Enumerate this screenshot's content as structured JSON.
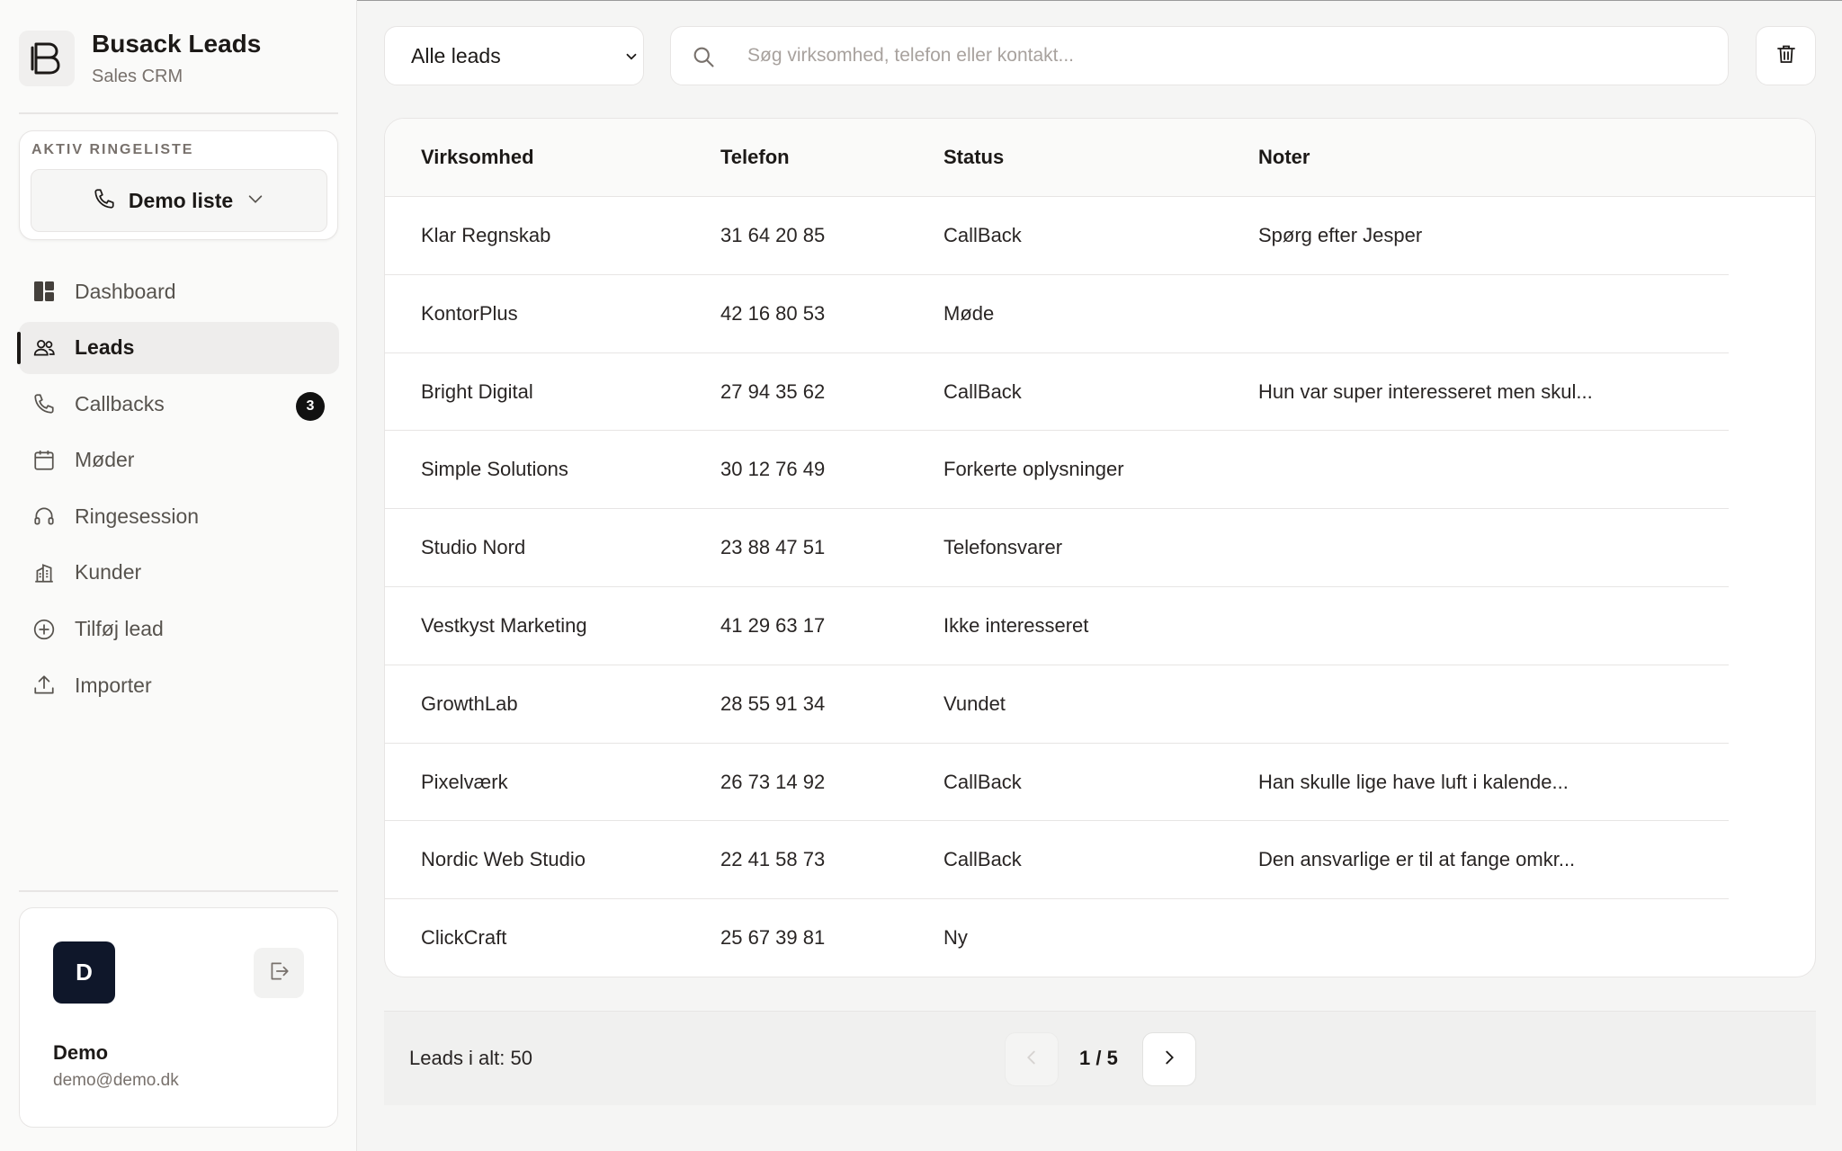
{
  "brand": {
    "title": "Busack Leads",
    "subtitle": "Sales CRM",
    "logo_icon": "b-logo-icon"
  },
  "call_list": {
    "label": "AKTIV RINGELISTE",
    "selected": "Demo liste"
  },
  "nav": {
    "items": [
      {
        "label": "Dashboard",
        "icon": "dashboard-icon",
        "active": false
      },
      {
        "label": "Leads",
        "icon": "users-icon",
        "active": true
      },
      {
        "label": "Callbacks",
        "icon": "phone-icon",
        "active": false,
        "badge": "3"
      },
      {
        "label": "Møder",
        "icon": "calendar-icon",
        "active": false
      },
      {
        "label": "Ringesession",
        "icon": "headset-icon",
        "active": false
      },
      {
        "label": "Kunder",
        "icon": "building-icon",
        "active": false
      },
      {
        "label": "Tilføj lead",
        "icon": "plus-circle-icon",
        "active": false
      },
      {
        "label": "Importer",
        "icon": "upload-icon",
        "active": false
      }
    ]
  },
  "user": {
    "initial": "D",
    "name": "Demo",
    "email": "demo@demo.dk"
  },
  "toolbar": {
    "filter_value": "Alle leads",
    "search_placeholder": "Søg virksomhed, telefon eller kontakt...",
    "search_value": ""
  },
  "table": {
    "columns": [
      "Virksomhed",
      "Telefon",
      "Status",
      "Noter"
    ],
    "rows": [
      [
        "Klar Regnskab",
        "31 64 20 85",
        "CallBack",
        "Spørg efter Jesper"
      ],
      [
        "KontorPlus",
        "42 16 80 53",
        "Møde",
        ""
      ],
      [
        "Bright Digital",
        "27 94 35 62",
        "CallBack",
        "Hun var super interesseret men skul..."
      ],
      [
        "Simple Solutions",
        "30 12 76 49",
        "Forkerte oplysninger",
        ""
      ],
      [
        "Studio Nord",
        "23 88 47 51",
        "Telefonsvarer",
        ""
      ],
      [
        "Vestkyst Marketing",
        "41 29 63 17",
        "Ikke interesseret",
        ""
      ],
      [
        "GrowthLab",
        "28 55 91 34",
        "Vundet",
        ""
      ],
      [
        "Pixelværk",
        "26 73 14 92",
        "CallBack",
        "Han skulle lige have luft i kalende..."
      ],
      [
        "Nordic Web Studio",
        "22 41 58 73",
        "CallBack",
        "Den ansvarlige er til at fange omkr..."
      ],
      [
        "ClickCraft",
        "25 67 39 81",
        "Ny",
        ""
      ]
    ]
  },
  "footer": {
    "total": "Leads i alt: 50",
    "page_indicator": "1 / 5"
  },
  "colors": {
    "accent": "#1c1917",
    "badge_bg": "#111111",
    "avatar_bg": "#0f172a"
  }
}
